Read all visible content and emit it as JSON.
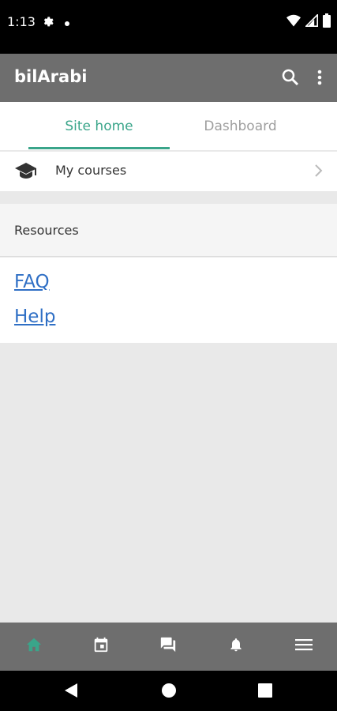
{
  "status_bar": {
    "time": "1:13",
    "icons": [
      "settings-icon",
      "notification-dot-icon",
      "wifi-icon",
      "signal-icon",
      "battery-icon"
    ]
  },
  "app_bar": {
    "title": "bilArabi",
    "icons": [
      "search-icon",
      "more-vert-icon"
    ]
  },
  "tabs": [
    {
      "label": "Site home",
      "active": true
    },
    {
      "label": "Dashboard",
      "active": false
    }
  ],
  "my_courses": {
    "label": "My courses",
    "icon": "graduation-cap-icon"
  },
  "resources": {
    "header": "Resources",
    "links": [
      "FAQ",
      "Help"
    ]
  },
  "bottom_nav": {
    "items": [
      "home-icon",
      "calendar-icon",
      "messages-icon",
      "notifications-icon",
      "menu-icon"
    ],
    "active_index": 0
  },
  "colors": {
    "accent": "#3aa58a",
    "app_bar": "#6e6e6e",
    "link": "#2f6fc5",
    "background": "#e9e9e9"
  }
}
